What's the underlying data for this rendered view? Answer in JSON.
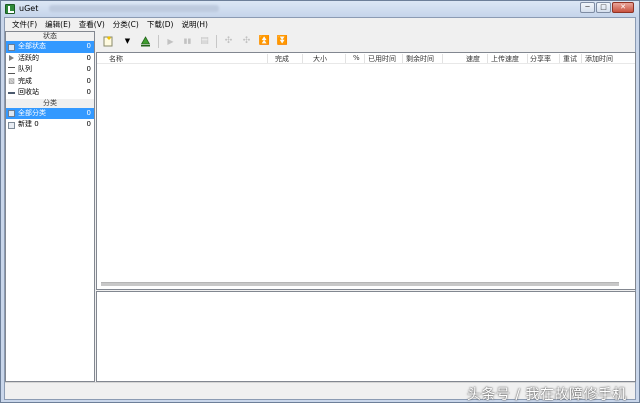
{
  "window": {
    "title": "uGet",
    "controls": {
      "minimize": "─",
      "maximize": "□",
      "close": "✕"
    }
  },
  "menu": [
    "文件(F)",
    "编辑(E)",
    "查看(V)",
    "分类(C)",
    "下载(D)",
    "说明(H)"
  ],
  "sidebar": {
    "status_header": "状态",
    "status_items": [
      {
        "label": "全部状态",
        "count": "0",
        "icon": "download-icon",
        "selected": true
      },
      {
        "label": "活跃的",
        "count": "0",
        "icon": "play-icon"
      },
      {
        "label": "队列",
        "count": "0",
        "icon": "queue-icon"
      },
      {
        "label": "完成",
        "count": "0",
        "icon": "finished-icon"
      },
      {
        "label": "回收站",
        "count": "0",
        "icon": "recycle-bin-icon"
      }
    ],
    "category_header": "分类",
    "category_items": [
      {
        "label": "全部分类",
        "count": "0",
        "selected": true
      },
      {
        "label": "新建 0",
        "count": "0",
        "icon": "category-icon"
      }
    ]
  },
  "toolbar": {
    "buttons": [
      "new-download-icon",
      "dropdown-arrow-icon",
      "add-torrent-icon",
      "start-icon",
      "pause-icon",
      "properties-icon",
      "move-up-icon",
      "move-down-icon",
      "move-top-icon",
      "move-bottom-icon"
    ]
  },
  "columns": [
    "名称",
    "完成",
    "大小",
    "%",
    "已用时间",
    "剩余时间",
    "速度",
    "上传速度",
    "分享率",
    "重试",
    "添加时间"
  ],
  "watermark": "头条号 / 我在故障修手机",
  "colors": {
    "selection": "#3399ff",
    "title_bar": "#c9d6ea",
    "add_icon_green": "#2f8a3a"
  }
}
